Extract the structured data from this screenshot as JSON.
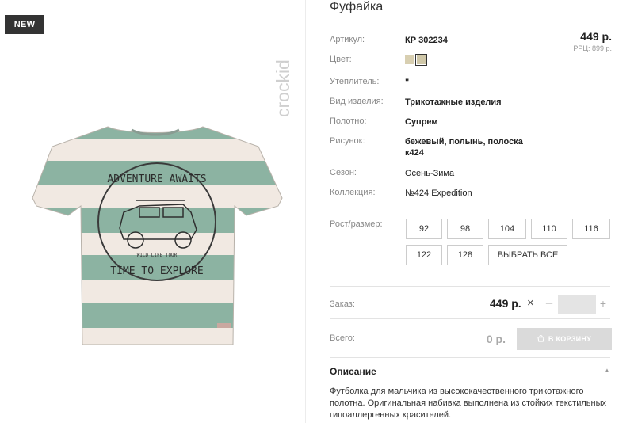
{
  "badge": "NEW",
  "brand": {
    "logo_text": "crockid"
  },
  "product": {
    "title": "Фуфайка",
    "price": "449 р.",
    "rrp": "РРЦ: 899 р."
  },
  "specs": {
    "article_label": "Артикул:",
    "article_value": "КР 302234",
    "color_label": "Цвет:",
    "insulation_label": "Утеплитель:",
    "insulation_value": "\"",
    "type_label": "Вид изделия:",
    "type_value": "Трикотажные изделия",
    "fabric_label": "Полотно:",
    "fabric_value": "Супрем",
    "pattern_label": "Рисунок:",
    "pattern_value": "бежевый, полынь, полоска к424",
    "season_label": "Сезон:",
    "season_value": "Осень-Зима",
    "collection_label": "Коллекция:",
    "collection_value": "№424 Expedition"
  },
  "colors": [
    "#d8cfb1",
    "#cfc7a8"
  ],
  "sizes": {
    "label": "Рост/размер:",
    "options": [
      "92",
      "98",
      "104",
      "110",
      "116",
      "122",
      "128"
    ],
    "select_all": "ВЫБРАТЬ ВСЕ"
  },
  "order": {
    "label": "Заказ:",
    "price": "449 р.",
    "times": "×",
    "minus": "–",
    "plus": "+",
    "qty": ""
  },
  "total": {
    "label": "Всего:",
    "value": "0 р.",
    "cart_button": "В КОРЗИНУ"
  },
  "description": {
    "title": "Описание",
    "text": "Футболка для мальчика из высококачественного трикотажного полотна. Оригинальная набивка выполнена из стойких текстильных гипоаллергенных красителей."
  },
  "print": {
    "top_text": "ADVENTURE AWAITS",
    "bottom_text": "TIME TO EXPLORE",
    "middle_text": "WILD LIFE TOUR"
  }
}
